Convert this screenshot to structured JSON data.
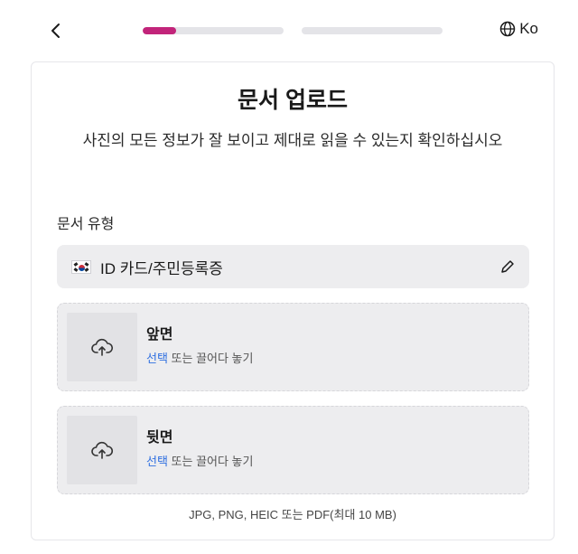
{
  "nav": {
    "back_icon": "chevron-left-icon",
    "progress": [
      {
        "fill": 0.24,
        "color": "#c2247a"
      },
      {
        "fill": 0.0,
        "color": "#c2247a"
      }
    ],
    "language": {
      "icon": "globe-icon",
      "label": "Ko"
    }
  },
  "card": {
    "title": "문서 업로드",
    "subtitle": "사진의 모든 정보가 잘 보이고 제대로 읽을 수 있는지 확인하십시오",
    "doc_type_label": "문서 유형",
    "doc_select": {
      "flag_icon": "korea-flag-icon",
      "value": "ID 카드/주민등록증",
      "edit_icon": "pencil-icon"
    },
    "uploads": [
      {
        "title": "앞면",
        "link": "선택",
        "hint": " 또는 끌어다 놓기",
        "icon": "cloud-upload-icon"
      },
      {
        "title": "뒷면",
        "link": "선택",
        "hint": " 또는 끌어다 놓기",
        "icon": "cloud-upload-icon"
      }
    ],
    "formats": "JPG, PNG, HEIC 또는 PDF(최대 10 MB)"
  },
  "colors": {
    "accent": "#c2247a",
    "link": "#2f6fe0"
  }
}
